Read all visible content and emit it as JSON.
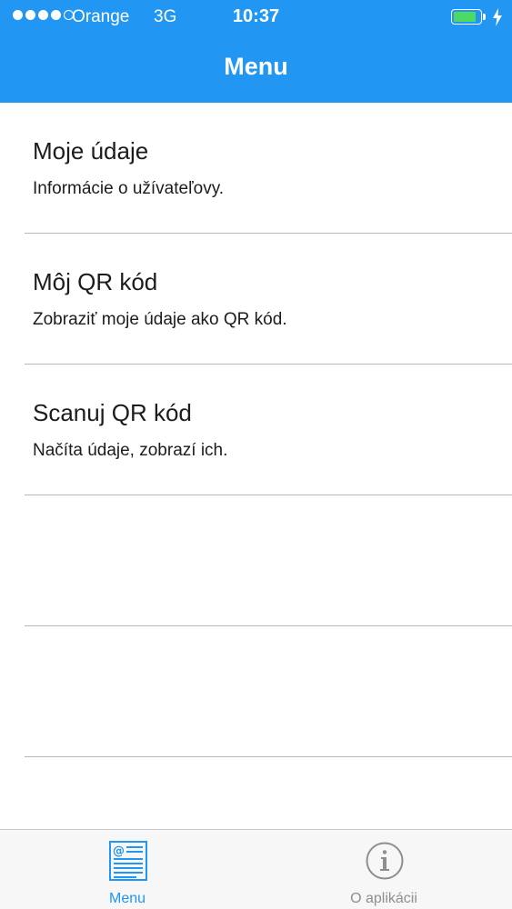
{
  "status_bar": {
    "carrier": "Orange",
    "network": "3G",
    "time": "10:37",
    "battery_level": 0.85,
    "signal_bars_filled": 4,
    "signal_bars_total": 5
  },
  "nav_bar": {
    "title": "Menu",
    "background_color": "#2196f3"
  },
  "menu_items": [
    {
      "title": "Moje údaje",
      "subtitle": "Informácie o užívateľovy."
    },
    {
      "title": "Môj QR kód",
      "subtitle": "Zobraziť moje údaje ako QR kód."
    },
    {
      "title": "Scanuj QR kód",
      "subtitle": "Načíta údaje, zobrazí ich."
    },
    {
      "title": "",
      "subtitle": ""
    },
    {
      "title": "",
      "subtitle": ""
    }
  ],
  "tab_bar": {
    "tabs": [
      {
        "label": "Menu",
        "icon": "newspaper-icon",
        "selected": true
      },
      {
        "label": "O aplikácii",
        "icon": "info-icon",
        "selected": false
      }
    ],
    "active_color": "#2196f3",
    "inactive_color": "#8e8e93"
  }
}
